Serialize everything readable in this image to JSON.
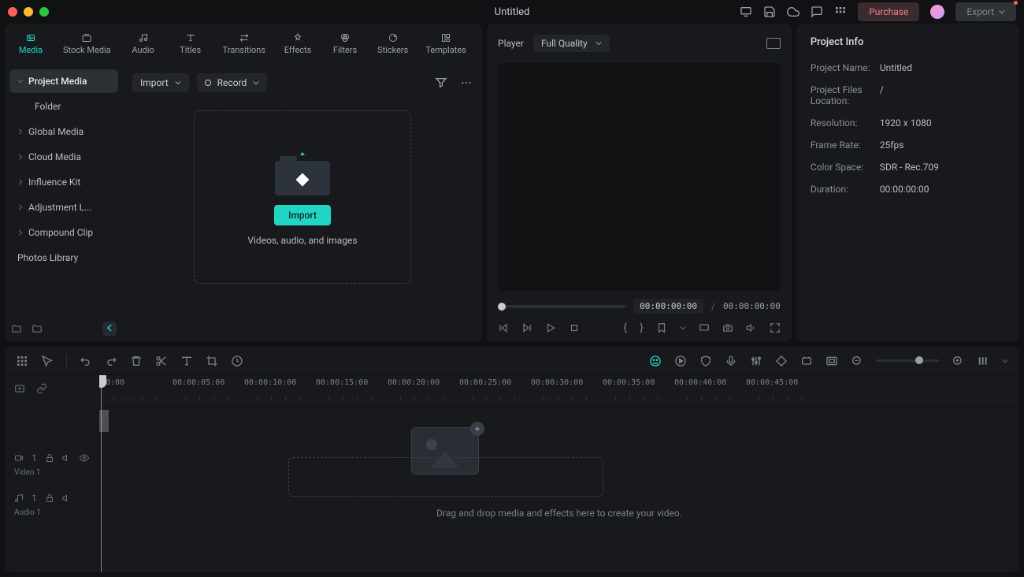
{
  "window": {
    "title": "Untitled"
  },
  "topbar": {
    "purchase": "Purchase",
    "export": "Export"
  },
  "tabs": [
    {
      "label": "Media",
      "icon": "media",
      "active": true
    },
    {
      "label": "Stock Media",
      "icon": "stock"
    },
    {
      "label": "Audio",
      "icon": "audio"
    },
    {
      "label": "Titles",
      "icon": "titles"
    },
    {
      "label": "Transitions",
      "icon": "transitions"
    },
    {
      "label": "Effects",
      "icon": "effects"
    },
    {
      "label": "Filters",
      "icon": "filters"
    },
    {
      "label": "Stickers",
      "icon": "stickers"
    },
    {
      "label": "Templates",
      "icon": "templates"
    }
  ],
  "sidebar": {
    "project_media": "Project Media",
    "folder": "Folder",
    "global_media": "Global Media",
    "cloud_media": "Cloud Media",
    "influence_kit": "Influence Kit",
    "adjustment": "Adjustment L...",
    "compound_clip": "Compound Clip",
    "photos_library": "Photos Library"
  },
  "media_toolbar": {
    "import": "Import",
    "record": "Record"
  },
  "dropzone": {
    "button": "Import",
    "hint": "Videos, audio, and images"
  },
  "player": {
    "label": "Player",
    "quality": "Full Quality",
    "current": "00:00:00:00",
    "sep": "/",
    "total": "00:00:00:00"
  },
  "info": {
    "title": "Project Info",
    "name_label": "Project Name:",
    "name_val": "Untitled",
    "loc_label": "Project Files Location:",
    "loc_val": "/",
    "res_label": "Resolution:",
    "res_val": "1920 x 1080",
    "fps_label": "Frame Rate:",
    "fps_val": "25fps",
    "cs_label": "Color Space:",
    "cs_val": "SDR - Rec.709",
    "dur_label": "Duration:",
    "dur_val": "00:00:00:00"
  },
  "ruler": [
    "00:00",
    "00:00:05:00",
    "00:00:10:00",
    "00:00:15:00",
    "00:00:20:00",
    "00:00:25:00",
    "00:00:30:00",
    "00:00:35:00",
    "00:00:40:00",
    "00:00:45:00"
  ],
  "tracks": {
    "video_num": "1",
    "video_label": "Video 1",
    "audio_num": "1",
    "audio_label": "Audio 1"
  },
  "timeline_hint": "Drag and drop media and effects here to create your video."
}
